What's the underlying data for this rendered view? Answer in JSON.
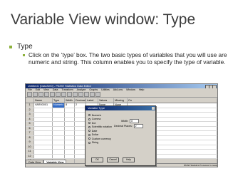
{
  "slide": {
    "title": "Variable View window: Type",
    "bullet1": "Type",
    "bullet2": "Click on the ‘type’ box. The two basic types of variables that you will use are numeric and string. This column enables you to specify the type of variable."
  },
  "window": {
    "title": "Untitled1 [DataSet0] - PASW Statistics Data Editor",
    "menu": [
      "File",
      "Edit",
      "View",
      "Data",
      "Transform",
      "Analyze",
      "Graphs",
      "Utilities",
      "Add-ons",
      "Window",
      "Help"
    ],
    "columns": [
      "",
      "Name",
      "Type",
      "Width",
      "Decimals",
      "Label",
      "Values",
      "Missing",
      "Co"
    ],
    "row1": {
      "num": "1",
      "name": "VAR00001",
      "type": "Numeric",
      "width": "8",
      "decimals": "2",
      "label": "",
      "values": "None",
      "missing": "None"
    },
    "row_numbers": [
      "2",
      "3",
      "4",
      "5",
      "6",
      "7",
      "8",
      "9",
      "10",
      "11",
      "12",
      "13"
    ],
    "tabs": {
      "data_view": "Data View",
      "variable_view": "Variable View"
    },
    "status": "PASW Statistics Processor is ready"
  },
  "dialog": {
    "title": "Variable Type",
    "options": [
      "Numeric",
      "Comma",
      "Dot",
      "Scientific notation",
      "Date",
      "Dollar",
      "Custom currency",
      "String"
    ],
    "selected_index": 0,
    "width_label": "Width:",
    "width_value": "8",
    "decimals_label": "Decimal Places:",
    "decimals_value": "2",
    "buttons": {
      "ok": "OK",
      "cancel": "Cancel",
      "help": "Help"
    }
  }
}
